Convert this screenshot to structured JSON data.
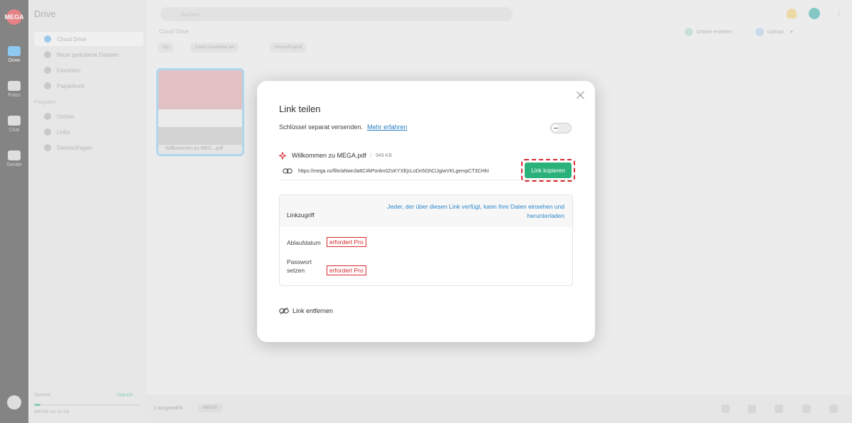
{
  "background": {
    "rail": {
      "logo": "MEGA",
      "items": [
        {
          "label": "Drive",
          "icon": "folder-icon"
        },
        {
          "label": "Fotos",
          "icon": "photo-icon"
        },
        {
          "label": "Chat",
          "icon": "chat-icon"
        },
        {
          "label": "Geräte",
          "icon": "devices-icon"
        }
      ]
    },
    "sidebar": {
      "title": "Drive",
      "items": [
        {
          "label": "Cloud Drive"
        },
        {
          "label": "Neue geänderte Dateien"
        },
        {
          "label": "Favoriten"
        },
        {
          "label": "Papierkorb"
        }
      ],
      "section": "Freigaben",
      "shared_items": [
        {
          "label": "Ordner"
        },
        {
          "label": "Links"
        },
        {
          "label": "Dateianfragen"
        }
      ],
      "storage_label": "Speicher",
      "storage_upgrade": "Upgrade",
      "storage_text": "949 KB von 20 GB",
      "storage_fraction": 0.06
    },
    "header": {
      "search_placeholder": "Suchen",
      "breadcrumb": "Cloud Drive",
      "new_folder": "Ordner erstellen",
      "upload": "Upload"
    },
    "chips": [
      "Typ",
      "Zuletzt bearbeitet am",
      "Herkunftsgerät"
    ],
    "file_caption": "Willkommen zu MEG...pdf",
    "bottom": {
      "selected_text": "1 ausgewählt",
      "pill": "949 KB"
    }
  },
  "dialog": {
    "title": "Link teilen",
    "key_text": "Schlüssel separat versenden.",
    "key_link": "Mehr erfahren",
    "toggle_on": false,
    "file_name": "Willkommen zu MEGA.pdf",
    "file_size": "949 KB",
    "url": "https://mega.nz/file/aNwn3a6C#kPonkn0ZsKYXEjcLoDn5GhCiJgiwVKLgervpCT3CHhI",
    "copy_button": "Link kopieren",
    "access_label": "Linkzugriff",
    "access_desc": "Jeder, der über diesen Link verfügt, kann Ihre Daten einsehen und herunterladen",
    "expiry_label": "Ablaufdatum",
    "password_label": "Passwort setzen",
    "pro_tag": "erfordert Pro",
    "remove_link": "Link entfernen"
  }
}
